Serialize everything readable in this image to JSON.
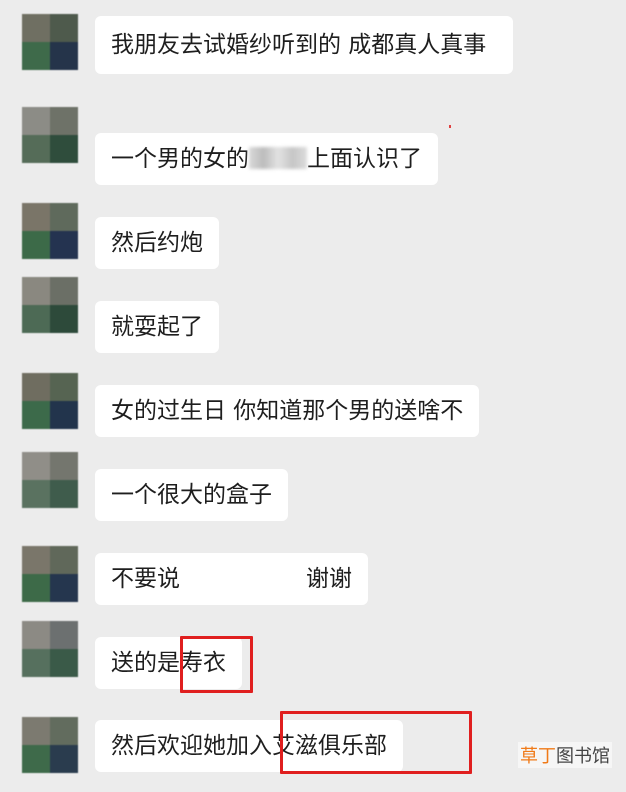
{
  "messages": [
    {
      "text": "我朋友去试婚纱听到的 成都真人真事"
    },
    {
      "text_before": "一个男的女的",
      "text_after": "上面认识了"
    },
    {
      "text": "然后约炮"
    },
    {
      "text": "就耍起了"
    },
    {
      "text": "女的过生日 你知道那个男的送啥不"
    },
    {
      "text": "一个很大的盒子"
    },
    {
      "text_before": "不要说",
      "text_after": "谢谢"
    },
    {
      "text": "送的是寿衣"
    },
    {
      "text": "然后欢迎她加入艾滋俱乐部"
    }
  ],
  "watermark": {
    "accent": "草丁",
    "rest": "图书馆"
  },
  "colors": {
    "background": "#ececec",
    "bubble": "#ffffff",
    "highlight_box": "#e01f1f",
    "watermark_accent": "#f07a18"
  }
}
